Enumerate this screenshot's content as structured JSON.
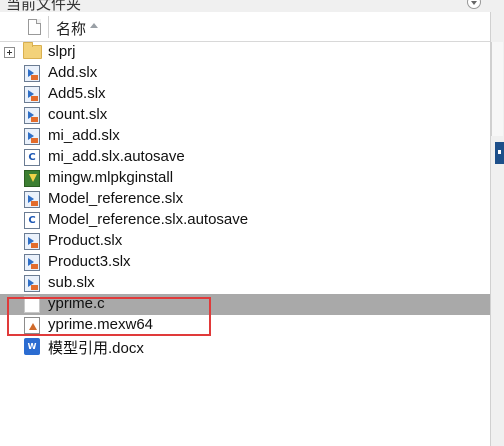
{
  "panel": {
    "title": "当前文件夹"
  },
  "columns": {
    "name": "名称",
    "sort": "ascending"
  },
  "files": [
    {
      "name": "slprj",
      "icon": "folder-icon",
      "expandable": true,
      "selected": false
    },
    {
      "name": "Add.slx",
      "icon": "simulink-model-icon",
      "expandable": false,
      "selected": false
    },
    {
      "name": "Add5.slx",
      "icon": "simulink-model-icon",
      "expandable": false,
      "selected": false
    },
    {
      "name": "count.slx",
      "icon": "simulink-model-icon",
      "expandable": false,
      "selected": false
    },
    {
      "name": "mi_add.slx",
      "icon": "simulink-model-icon",
      "expandable": false,
      "selected": false
    },
    {
      "name": "mi_add.slx.autosave",
      "icon": "autosave-file-icon",
      "expandable": false,
      "selected": false
    },
    {
      "name": "mingw.mlpkginstall",
      "icon": "package-install-icon",
      "expandable": false,
      "selected": false
    },
    {
      "name": "Model_reference.slx",
      "icon": "simulink-model-icon",
      "expandable": false,
      "selected": false
    },
    {
      "name": "Model_reference.slx.autosave",
      "icon": "autosave-file-icon",
      "expandable": false,
      "selected": false
    },
    {
      "name": "Product.slx",
      "icon": "simulink-model-icon",
      "expandable": false,
      "selected": false
    },
    {
      "name": "Product3.slx",
      "icon": "simulink-model-icon",
      "expandable": false,
      "selected": false
    },
    {
      "name": "sub.slx",
      "icon": "simulink-model-icon",
      "expandable": false,
      "selected": false
    },
    {
      "name": "yprime.c",
      "icon": "c-source-file-icon",
      "expandable": false,
      "selected": true
    },
    {
      "name": "yprime.mexw64",
      "icon": "mex-file-icon",
      "expandable": false,
      "selected": false
    },
    {
      "name": "模型引用.docx",
      "icon": "word-document-icon",
      "expandable": false,
      "selected": false
    }
  ],
  "colors": {
    "selection": "#a9a9a9",
    "annotation_box": "#e03a3a"
  }
}
